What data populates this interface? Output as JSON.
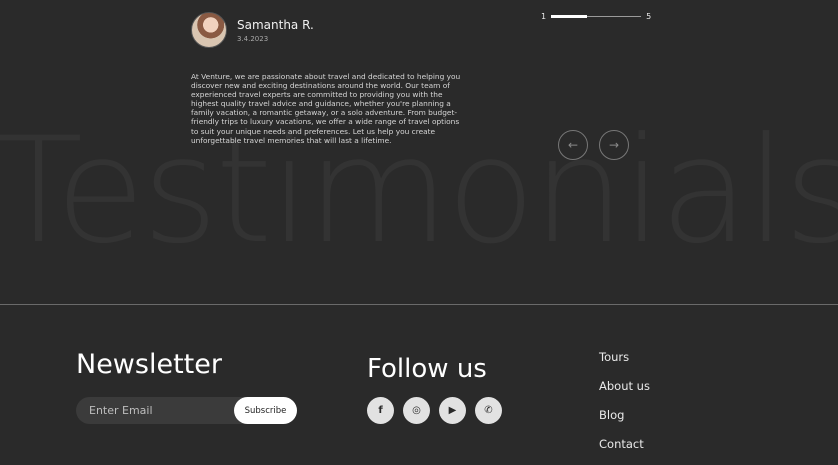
{
  "background_word": "Testimonials",
  "testimonial": {
    "name": "Samantha R.",
    "date": "3.4.2023",
    "text": "At Venture, we are passionate about travel and dedicated to helping you discover new and exciting destinations around the world. Our team of experienced travel experts are committed to providing you with the highest quality travel advice and guidance, whether you're planning a family vacation, a romantic getaway, or a solo adventure. From budget-friendly trips to luxury vacations, we offer a wide range of travel options to suit your unique needs and preferences. Let us help you create unforgettable travel memories that will last a lifetime."
  },
  "pager": {
    "start": "1",
    "end": "5",
    "progress": 0.4
  },
  "arrows": {
    "prev": "←",
    "next": "→"
  },
  "newsletter": {
    "title": "Newsletter",
    "placeholder": "Enter Email",
    "button": "Subscribe"
  },
  "follow": {
    "title": "Follow us",
    "icons": [
      {
        "name": "facebook-icon",
        "glyph": "f"
      },
      {
        "name": "instagram-icon",
        "glyph": "◎"
      },
      {
        "name": "youtube-icon",
        "glyph": "▶"
      },
      {
        "name": "whatsapp-icon",
        "glyph": "✆"
      }
    ]
  },
  "nav": [
    "Tours",
    "About us",
    "Blog",
    "Contact"
  ],
  "colors": {
    "background": "#2a2a2a",
    "accent": "#ffffff"
  }
}
